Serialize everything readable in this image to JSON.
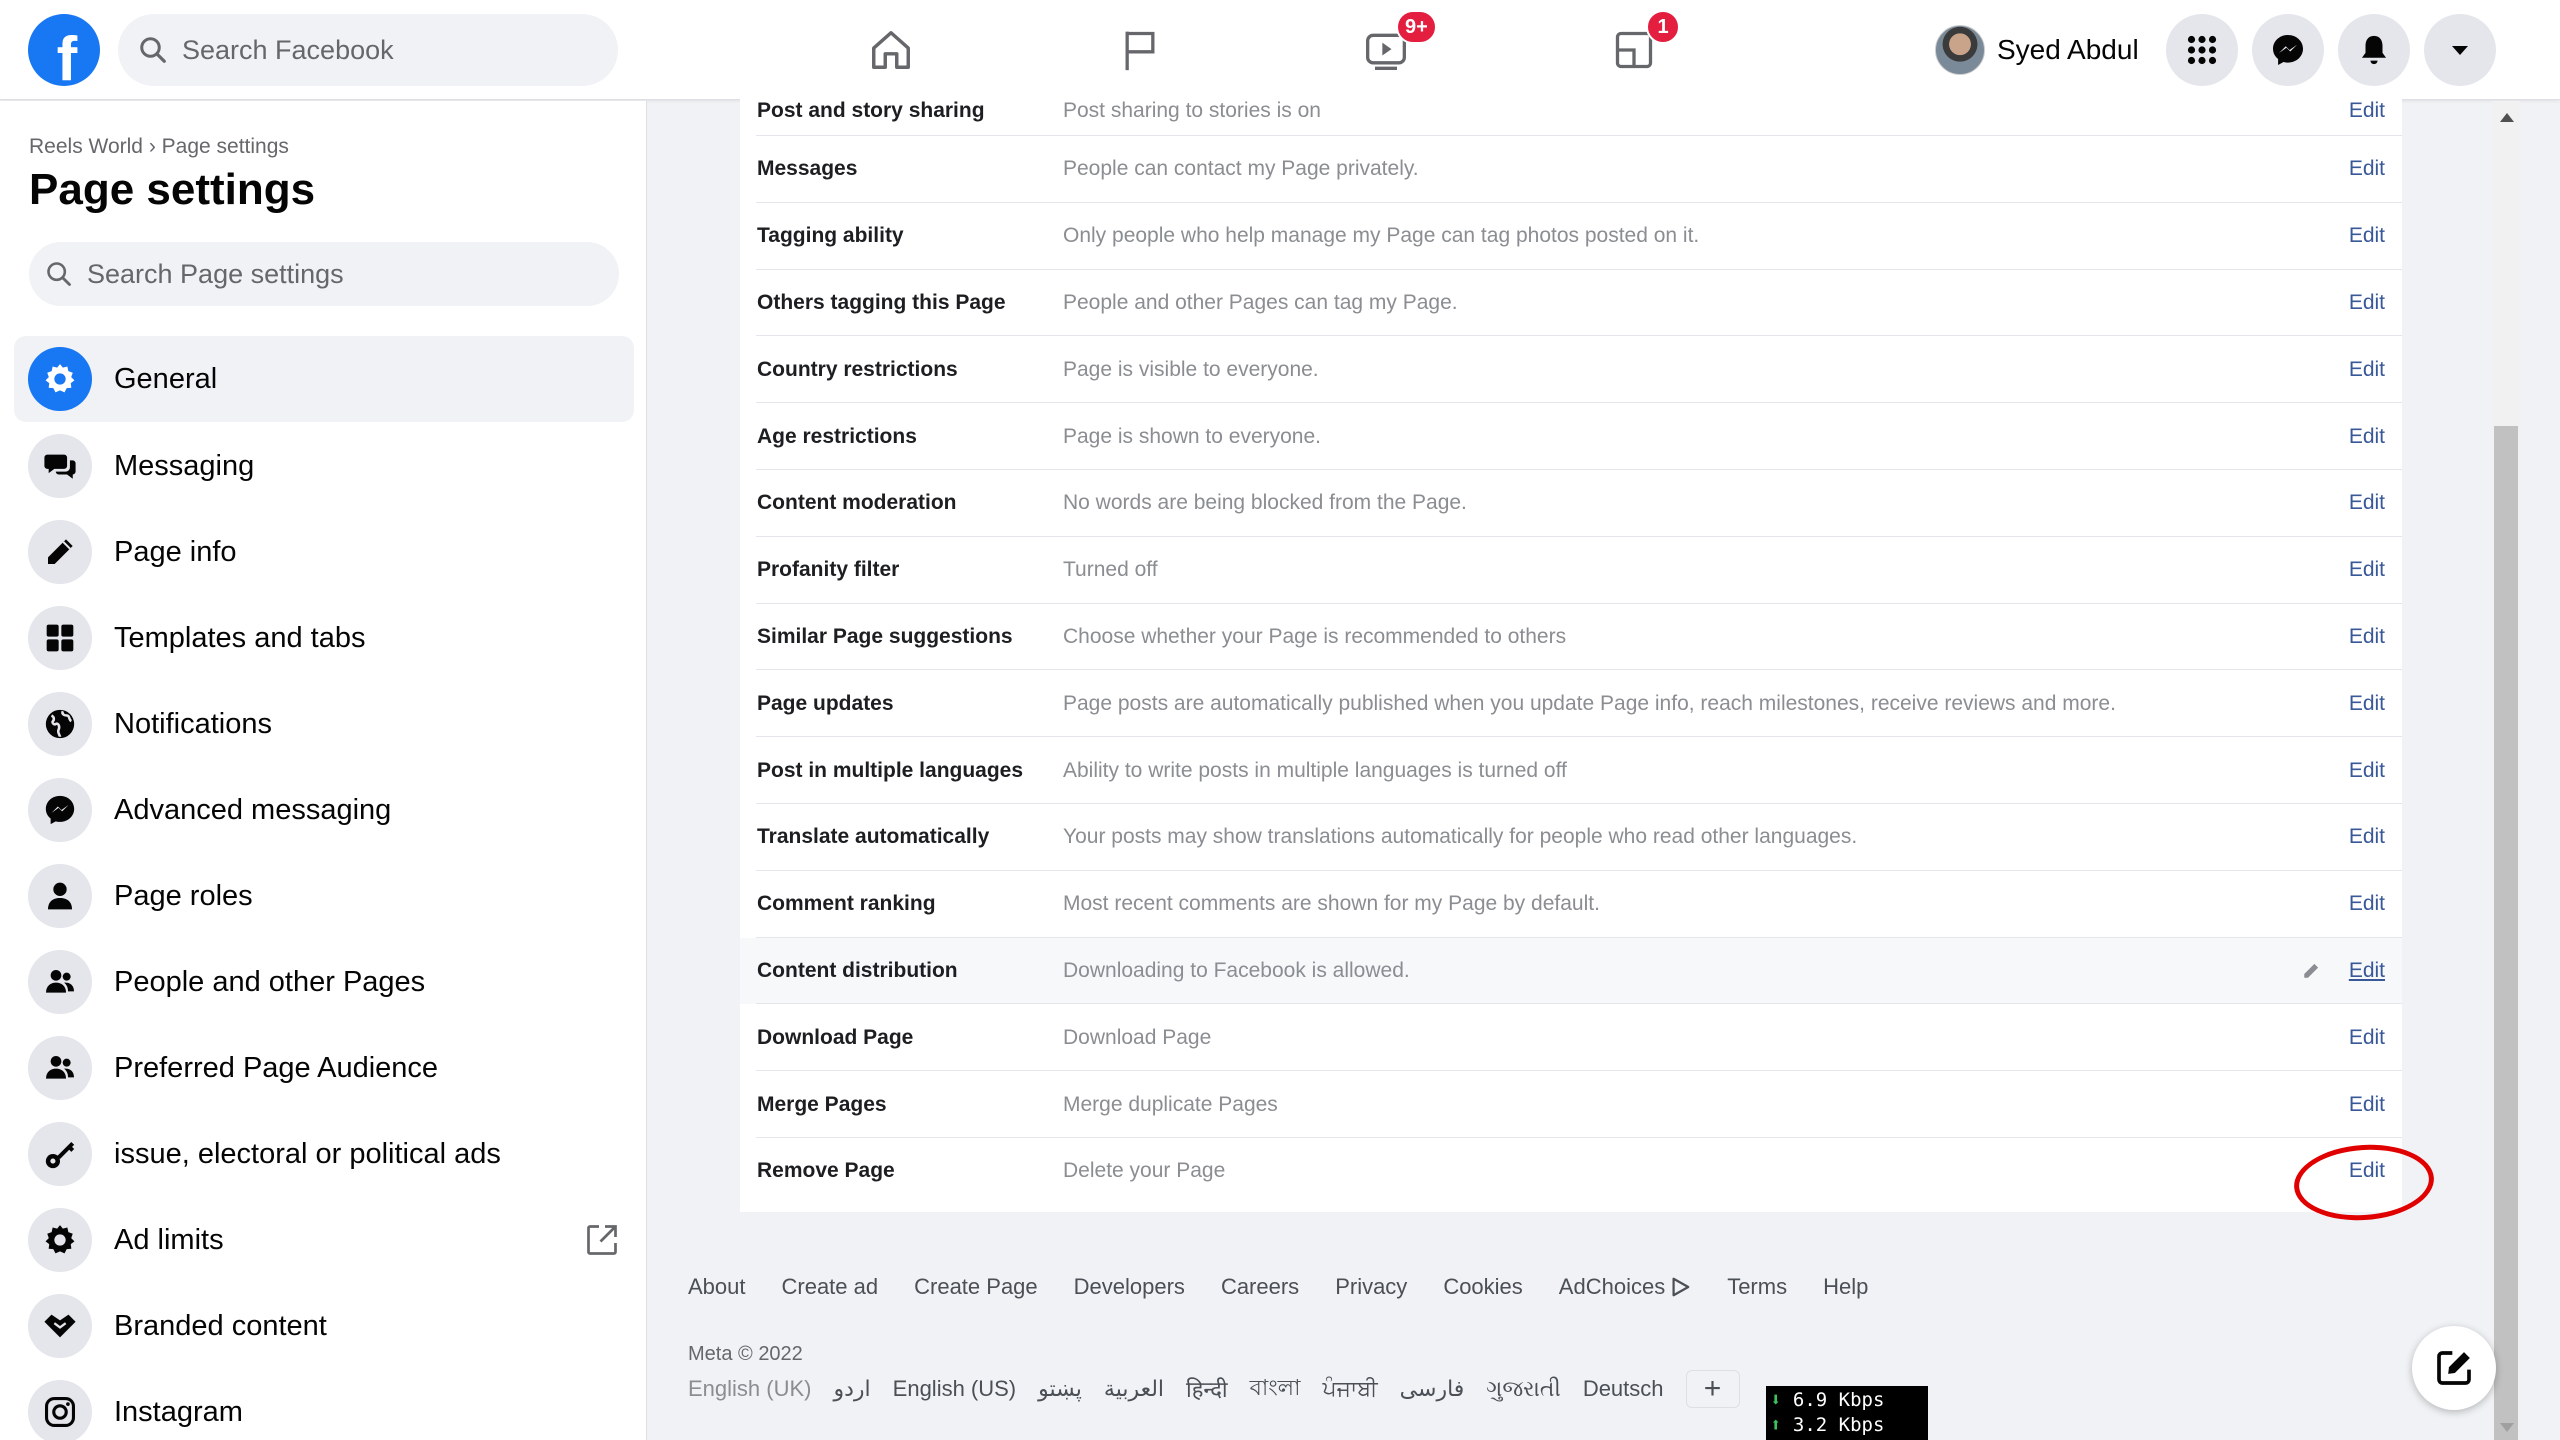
{
  "topbar": {
    "logo": "f",
    "search_placeholder": "Search Facebook",
    "nav": [
      {
        "icon": "home-icon",
        "badge": ""
      },
      {
        "icon": "flag-icon",
        "badge": ""
      },
      {
        "icon": "video-icon",
        "badge": "9+"
      },
      {
        "icon": "gaming-icon",
        "badge": "1"
      }
    ],
    "profile_name": "Syed Abdul",
    "buttons": [
      "menu-grid-icon",
      "messenger-icon",
      "bell-icon",
      "caret-down-icon"
    ]
  },
  "sidebar": {
    "breadcrumb": "Reels World › Page settings",
    "title": "Page settings",
    "search_placeholder": "Search Page settings",
    "items": [
      {
        "label": "General",
        "icon": "gear-icon",
        "active": true
      },
      {
        "label": "Messaging",
        "icon": "chat-bubbles-icon"
      },
      {
        "label": "Page info",
        "icon": "pencil-icon"
      },
      {
        "label": "Templates and tabs",
        "icon": "grid-icon"
      },
      {
        "label": "Notifications",
        "icon": "globe-icon"
      },
      {
        "label": "Advanced messaging",
        "icon": "messenger-icon"
      },
      {
        "label": "Page roles",
        "icon": "person-icon"
      },
      {
        "label": "People and other Pages",
        "icon": "people-icon"
      },
      {
        "label": "Preferred Page Audience",
        "icon": "people-icon"
      },
      {
        "label": "issue, electoral or political ads",
        "icon": "key-icon"
      },
      {
        "label": "Ad limits",
        "icon": "gear-icon"
      },
      {
        "label": "Branded content",
        "icon": "handshake-icon"
      },
      {
        "label": "Instagram",
        "icon": "instagram-icon"
      }
    ]
  },
  "settings": {
    "edit_label": "Edit",
    "rows": [
      {
        "label": "Post and story sharing",
        "value": "Post sharing to stories is on"
      },
      {
        "label": "Messages",
        "value": "People can contact my Page privately."
      },
      {
        "label": "Tagging ability",
        "value": "Only people who help manage my Page can tag photos posted on it."
      },
      {
        "label": "Others tagging this Page",
        "value": "People and other Pages can tag my Page."
      },
      {
        "label": "Country restrictions",
        "value": "Page is visible to everyone."
      },
      {
        "label": "Age restrictions",
        "value": "Page is shown to everyone."
      },
      {
        "label": "Content moderation",
        "value": "No words are being blocked from the Page."
      },
      {
        "label": "Profanity filter",
        "value": "Turned off"
      },
      {
        "label": "Similar Page suggestions",
        "value": "Choose whether your Page is recommended to others"
      },
      {
        "label": "Page updates",
        "value": "Page posts are automatically published when you update Page info, reach milestones, receive reviews and more."
      },
      {
        "label": "Post in multiple languages",
        "value": "Ability to write posts in multiple languages is turned off"
      },
      {
        "label": "Translate automatically",
        "value": "Your posts may show translations automatically for people who read other languages."
      },
      {
        "label": "Comment ranking",
        "value": "Most recent comments are shown for my Page by default."
      },
      {
        "label": "Content distribution",
        "value": "Downloading to Facebook is allowed."
      },
      {
        "label": "Download Page",
        "value": "Download Page"
      },
      {
        "label": "Merge Pages",
        "value": "Merge duplicate Pages"
      },
      {
        "label": "Remove Page",
        "value": "Delete your Page"
      }
    ]
  },
  "footer": {
    "links": [
      "About",
      "Create ad",
      "Create Page",
      "Developers",
      "Careers",
      "Privacy",
      "Cookies",
      "AdChoices",
      "Terms",
      "Help"
    ],
    "meta": "Meta © 2022",
    "languages": [
      "English (UK)",
      "اردو",
      "English (US)",
      "پښتو",
      "العربية",
      "हिन्दी",
      "বাংলা",
      "ਪੰਜਾਬੀ",
      "فارسی",
      "ગુજરાતી",
      "Deutsch"
    ],
    "add_language": "+"
  },
  "netspeed": {
    "down": "6.9 Kbps",
    "up": "3.2 Kbps"
  },
  "colors": {
    "accent": "#1877f2",
    "badge": "#e41e3f",
    "link": "#385898",
    "highlight": "#e00000"
  }
}
